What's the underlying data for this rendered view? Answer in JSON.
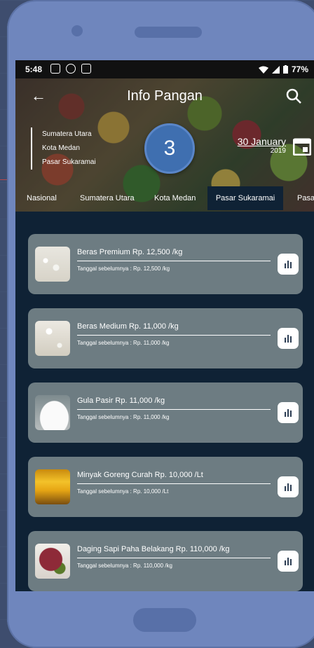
{
  "status_bar": {
    "time": "5:48",
    "battery": "77%"
  },
  "app_bar": {
    "title": "Info Pangan"
  },
  "location": {
    "province": "Sumatera Utara",
    "city": "Kota Medan",
    "market": "Pasar Sukaramai"
  },
  "date": {
    "day_month": "30 January",
    "year": "2019"
  },
  "step_badge": "3",
  "tabs": [
    {
      "label": "Nasional"
    },
    {
      "label": "Sumatera Utara"
    },
    {
      "label": "Kota Medan"
    },
    {
      "label": "Pasar Sukaramai"
    },
    {
      "label": "Pasar"
    }
  ],
  "commodities": [
    {
      "name": "Beras Premium Rp. 12,500 /kg",
      "previous": "Tanggal sebelumnya : Rp. 12,500 /kg",
      "icon": "rice-image"
    },
    {
      "name": "Beras Medium Rp. 11,000 /kg",
      "previous": "Tanggal sebelumnya : Rp. 11,000 /kg",
      "icon": "rice-image"
    },
    {
      "name": "Gula Pasir Rp. 11,000 /kg",
      "previous": "Tanggal sebelumnya : Rp. 11,000 /kg",
      "icon": "sugar-image"
    },
    {
      "name": "Minyak Goreng Curah Rp. 10,000 /Lt",
      "previous": "Tanggal sebelumnya : Rp. 10,000 /Lt",
      "icon": "cooking-oil-image"
    },
    {
      "name": "Daging Sapi Paha Belakang Rp. 110,000 /kg",
      "previous": "Tanggal sebelumnya : Rp. 110,000 /kg",
      "icon": "beef-image"
    }
  ],
  "colors": {
    "phone": "#6f86bd",
    "screen_bg": "#0f2235",
    "card": "#6d7c82",
    "badge": "#3f6fb0"
  }
}
